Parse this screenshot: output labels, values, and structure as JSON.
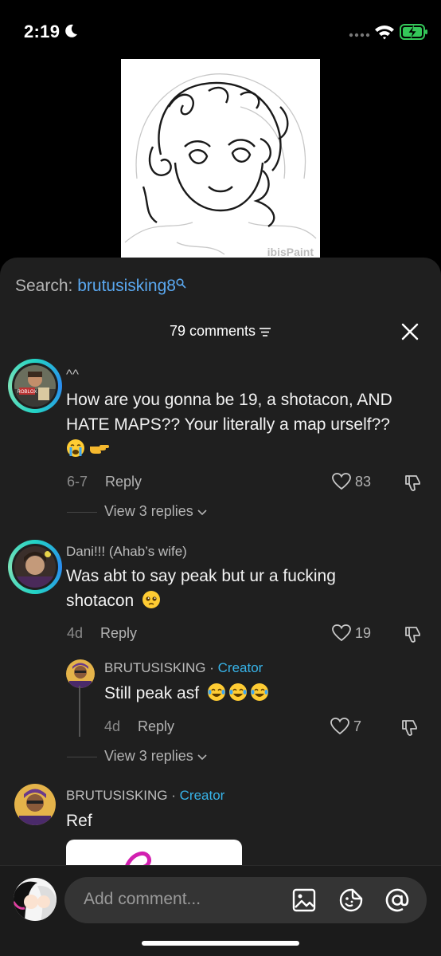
{
  "status_bar": {
    "time": "2:19"
  },
  "video": {
    "watermark": "ibisPaint"
  },
  "search": {
    "label": "Search:",
    "query": "brutusisking8"
  },
  "header": {
    "count_label": "79 comments"
  },
  "comments": [
    {
      "username": "^^",
      "text": "How are you gonna be 19, a shotacon, AND HATE MAPS?? Your literally a map urself??",
      "date": "6-7",
      "reply_label": "Reply",
      "likes": "83",
      "view_replies": "View 3 replies"
    },
    {
      "username": "Dani!!! (Ahab’s wife)",
      "text": "Was abt to say peak but ur a fucking shotacon",
      "date": "4d",
      "reply_label": "Reply",
      "likes": "19",
      "view_replies": "View 3 replies"
    },
    {
      "username": "BRUTUSISKING",
      "creator_label": "Creator",
      "text": "Still peak asf",
      "date": "4d",
      "reply_label": "Reply",
      "likes": "7"
    },
    {
      "username": "BRUTUSISKING",
      "creator_label": "Creator",
      "text": "Ref"
    }
  ],
  "bottom_bar": {
    "placeholder": "Add comment..."
  },
  "colors": {
    "accent_blue": "#5aa8f0",
    "creator": "#37b3e8",
    "sheet": "#1f1f1f"
  }
}
